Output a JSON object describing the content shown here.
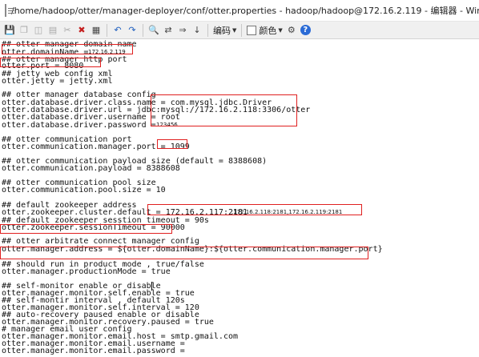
{
  "window": {
    "title": "/home/hadoop/otter/manager-deployer/conf/otter.properties - hadoop/hadoop@172.16.2.119 - 编辑器 - WinSCP"
  },
  "toolbar": {
    "encoding_label": "编码",
    "color_label": "颜色",
    "help_label": "?"
  },
  "editor": {
    "lines": [
      "## otter manager domain name",
      "otter.domainName = ",
      "## otter manager http port",
      "otter.port = 8080",
      "## jetty web config xml",
      "otter.jetty = jetty.xml",
      "",
      "## otter manager database config",
      "otter.database.driver.class.name = com.mysql.jdbc.Driver",
      "otter.database.driver.url = jdbc:mysql://172.16.2.118:3306/otter",
      "otter.database.driver.username = root",
      "otter.database.driver.password = ",
      "",
      "## otter communication port",
      "otter.communication.manager.port = 1099",
      "",
      "## otter communication payload size (default = 8388608)",
      "otter.communication.payload = 8388608",
      "",
      "## otter communication pool size",
      "otter.communication.pool.size = 10",
      "",
      "## default zookeeper address",
      "otter.zookeeper.cluster.default = 172.16.2.117:2181",
      "## default zookeeper sesstion timeout = 90s",
      "otter.zookeeper.sessionTimeout = 90000",
      "",
      "## otter arbitrate connect manager config",
      "otter.manager.address = ${otter.domainName}:${otter.communication.manager.port}",
      "",
      "## should run in product mode , true/false",
      "otter.manager.productionMode = true",
      "",
      "## self-monitor enable or disable",
      "otter.manager.monitor.self.enable = true",
      "## self-montir interval , default 120s",
      "otter.manager.monitor.self.interval = 120",
      "## auto-recovery paused enable or disable",
      "otter.manager.monitor.recovery.paused = true",
      "# manager email user config",
      "otter.manager.monitor.email.host = smtp.gmail.com",
      "otter.manager.monitor.email.username = ",
      "otter.manager.monitor.email.password = "
    ],
    "annotations": {
      "domain_ip": "172.16.2.119",
      "password": "123456",
      "zk_extra": ",172.16.2.118:2181,172.16.2.119:2181"
    }
  },
  "colors": {
    "highlight_box": "#e02020",
    "help_icon": "#2b6bd6"
  }
}
